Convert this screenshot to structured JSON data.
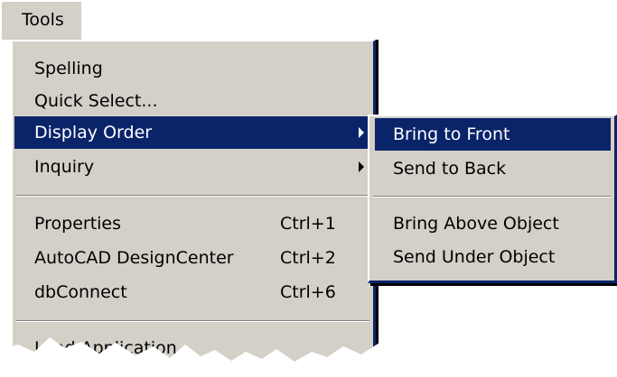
{
  "menubar": {
    "tools_label": "Tools"
  },
  "tools_menu": {
    "items": [
      {
        "label": "Spelling",
        "shortcut": ""
      },
      {
        "label": "Quick Select...",
        "shortcut": ""
      },
      {
        "label": "Display Order",
        "shortcut": "",
        "submenu": true,
        "selected": true
      },
      {
        "label": "Inquiry",
        "shortcut": "",
        "submenu": true
      },
      {
        "label": "Properties",
        "shortcut": "Ctrl+1"
      },
      {
        "label": "AutoCAD DesignCenter",
        "shortcut": "Ctrl+2"
      },
      {
        "label": "dbConnect",
        "shortcut": "Ctrl+6"
      },
      {
        "label": "Load Application...",
        "shortcut": ""
      }
    ]
  },
  "display_order_submenu": {
    "items": [
      {
        "label": "Bring to Front",
        "selected": true
      },
      {
        "label": "Send to Back"
      },
      {
        "label": "Bring Above Object"
      },
      {
        "label": "Send Under Object"
      }
    ]
  },
  "colors": {
    "menu_background": "#d4d0c8",
    "highlight": "#0a246a",
    "highlight_text": "#ffffff"
  }
}
